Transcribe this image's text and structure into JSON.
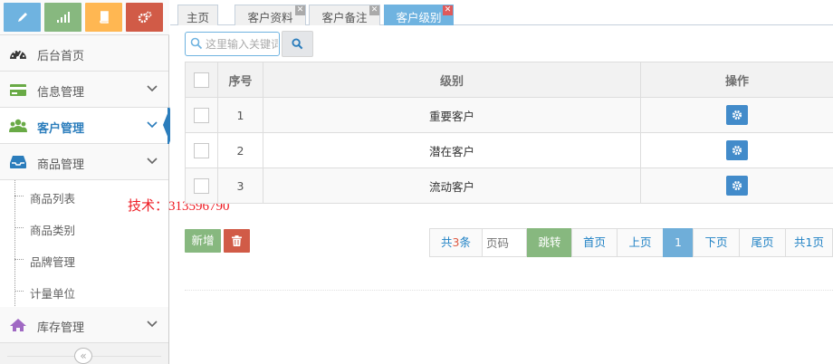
{
  "sidebar": {
    "shortcuts": [
      {
        "icon": "pencil-icon",
        "color": "#6fb3e0"
      },
      {
        "icon": "signal-icon",
        "color": "#87b87f"
      },
      {
        "icon": "book-icon",
        "color": "#ffb752"
      },
      {
        "icon": "cogs-icon",
        "color": "#d15b47"
      }
    ],
    "items": [
      {
        "label": "后台首页",
        "icon": "dashboard-icon"
      },
      {
        "label": "信息管理",
        "icon": "credit-card-icon"
      },
      {
        "label": "客户管理",
        "icon": "users-icon"
      },
      {
        "label": "商品管理",
        "icon": "inbox-icon"
      },
      {
        "label": "库存管理",
        "icon": "home-icon"
      }
    ],
    "submenu": [
      "商品列表",
      "商品类别",
      "品牌管理",
      "计量单位"
    ],
    "collapse_glyph": "«"
  },
  "watermark": "技术：313596790",
  "tabs": [
    {
      "label": "主页"
    },
    {
      "label": "客户资料"
    },
    {
      "label": "客户备注"
    },
    {
      "label": "客户级别"
    }
  ],
  "search": {
    "placeholder": "这里输入关键词",
    "value": ""
  },
  "table": {
    "headers": {
      "index": "序号",
      "level": "级别",
      "action": "操作"
    },
    "rows": [
      {
        "index": "1",
        "level": "重要客户"
      },
      {
        "index": "2",
        "level": "潜在客户"
      },
      {
        "index": "3",
        "level": "流动客户"
      }
    ]
  },
  "toolbar": {
    "add_label": "新增"
  },
  "pager": {
    "total_prefix": "共",
    "total_count": "3",
    "total_suffix": "条",
    "page_placeholder": "页码",
    "jump": "跳转",
    "first": "首页",
    "prev": "上页",
    "current": "1",
    "next": "下页",
    "last": "尾页",
    "pages": "共1页"
  },
  "colors": {
    "accent": "#2b7dbc",
    "tab_active": "#6fb3e0",
    "success": "#87b87f",
    "danger": "#d15b47",
    "gear": "#428bca"
  }
}
